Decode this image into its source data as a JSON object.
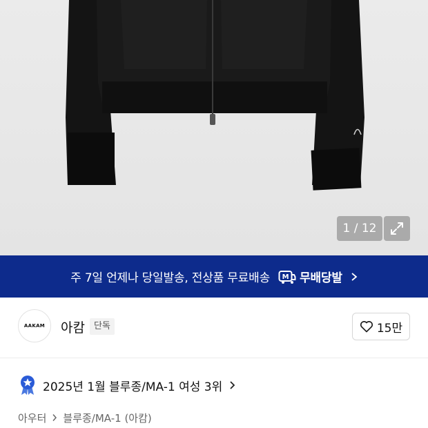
{
  "gallery": {
    "counter": "1 / 12",
    "expand_icon": "expand-arrows-icon"
  },
  "banner": {
    "text": "주 7일 언제나 당일발송, 전상품 무료배송",
    "badge_label": "무배당발",
    "badge_icon": "delivery-m-icon",
    "background": "#0d2b8c"
  },
  "brand": {
    "logo_text": "AAKAM",
    "name": "아캄",
    "tag": "단독",
    "likes": "15만",
    "like_icon": "heart-icon"
  },
  "ranking": {
    "text": "2025년 1월 블루종/MA-1 여성 3위",
    "medal_icon": "medal-star-icon",
    "medal_color": "#2a5bd7"
  },
  "category": {
    "level1": "아우터",
    "level2": "블루종/MA-1 (아캄)"
  }
}
